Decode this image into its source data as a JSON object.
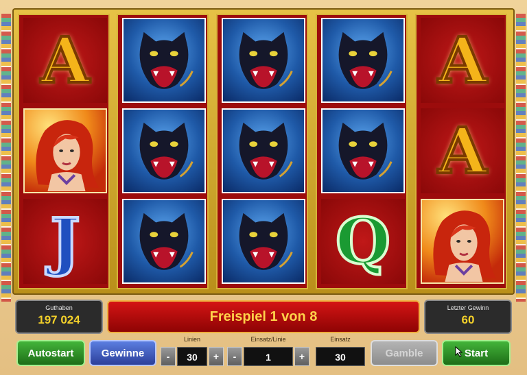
{
  "game": {
    "reels": [
      [
        "letter-A",
        "woman",
        "letter-J"
      ],
      [
        "panther",
        "panther",
        "panther"
      ],
      [
        "panther",
        "panther",
        "panther"
      ],
      [
        "panther",
        "panther",
        "letter-Q"
      ],
      [
        "letter-A",
        "letter-A",
        "woman"
      ]
    ],
    "letters": {
      "A": "A",
      "J": "J",
      "Q": "Q"
    }
  },
  "info": {
    "balance_label": "Guthaben",
    "balance_value": "197 024",
    "last_win_label": "Letzter Gewinn",
    "last_win_value": "60",
    "banner_text": "Freispiel 1 von 8"
  },
  "controls": {
    "autostart_label": "Autostart",
    "gewinne_label": "Gewinne",
    "lines_label": "Linien",
    "lines_value": "30",
    "bet_per_line_label": "Einsatz/Linie",
    "bet_per_line_value": "1",
    "bet_label": "Einsatz",
    "bet_value": "30",
    "gamble_label": "Gamble",
    "start_label": "Start",
    "minus": "-",
    "plus": "+"
  },
  "colors": {
    "frame_gold": "#d7b23a",
    "reel_red": "#9c0c0c",
    "panther_bg": "#1f5aa8",
    "banner_red": "#d41414",
    "value_yellow": "#f4d12a"
  }
}
